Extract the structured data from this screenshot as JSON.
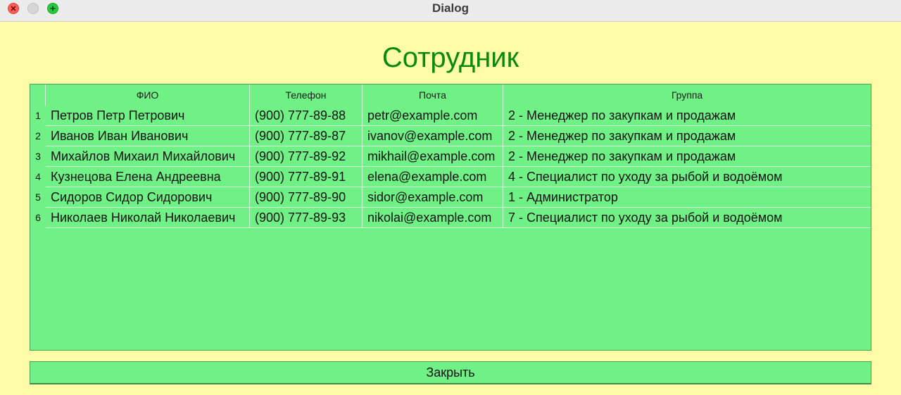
{
  "window": {
    "title": "Dialog"
  },
  "dialog": {
    "title": "Сотрудник",
    "close_label": "Закрыть"
  },
  "table": {
    "headers": [
      "ФИО",
      "Телефон",
      "Почта",
      "Группа"
    ],
    "rows": [
      {
        "num": "1",
        "fio": "Петров Петр Петрович",
        "phone": "(900) 777-89-88",
        "email": "petr@example.com",
        "group": "2 - Менеджер по закупкам и продажам"
      },
      {
        "num": "2",
        "fio": "Иванов Иван Иванович",
        "phone": "(900) 777-89-87",
        "email": "ivanov@example.com",
        "group": "2 - Менеджер по закупкам и продажам"
      },
      {
        "num": "3",
        "fio": "Михайлов Михаил Михайлович",
        "phone": "(900) 777-89-92",
        "email": "mikhail@example.com",
        "group": "2 - Менеджер по закупкам и продажам"
      },
      {
        "num": "4",
        "fio": "Кузнецова Елена Андреевна",
        "phone": "(900) 777-89-91",
        "email": "elena@example.com",
        "group": "4 - Специалист по уходу за рыбой и водоёмом"
      },
      {
        "num": "5",
        "fio": "Сидоров Сидор Сидорович",
        "phone": "(900) 777-89-90",
        "email": "sidor@example.com",
        "group": "1 - Администратор"
      },
      {
        "num": "6",
        "fio": "Николаев Николай Николаевич",
        "phone": "(900) 777-89-93",
        "email": "nikolai@example.com",
        "group": "7 - Специалист по уходу за рыбой и водоёмом"
      }
    ]
  }
}
